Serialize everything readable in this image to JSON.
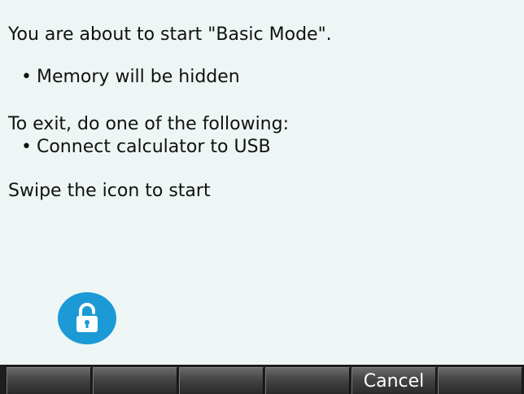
{
  "message": {
    "intro": "You are about to start \"Basic Mode\".",
    "bullet_memory": "Memory will be hidden",
    "exit_heading": "To exit, do one of the following:",
    "bullet_usb": "Connect calculator to USB",
    "instruction": "Swipe the icon to start"
  },
  "bullet_symbol": "•",
  "lock_icon": {
    "name": "unlock-icon",
    "color": "#1b9ad6"
  },
  "softkeys": {
    "key1": "",
    "key2": "",
    "key3": "",
    "key4": "",
    "key5": "Cancel",
    "key6": ""
  }
}
